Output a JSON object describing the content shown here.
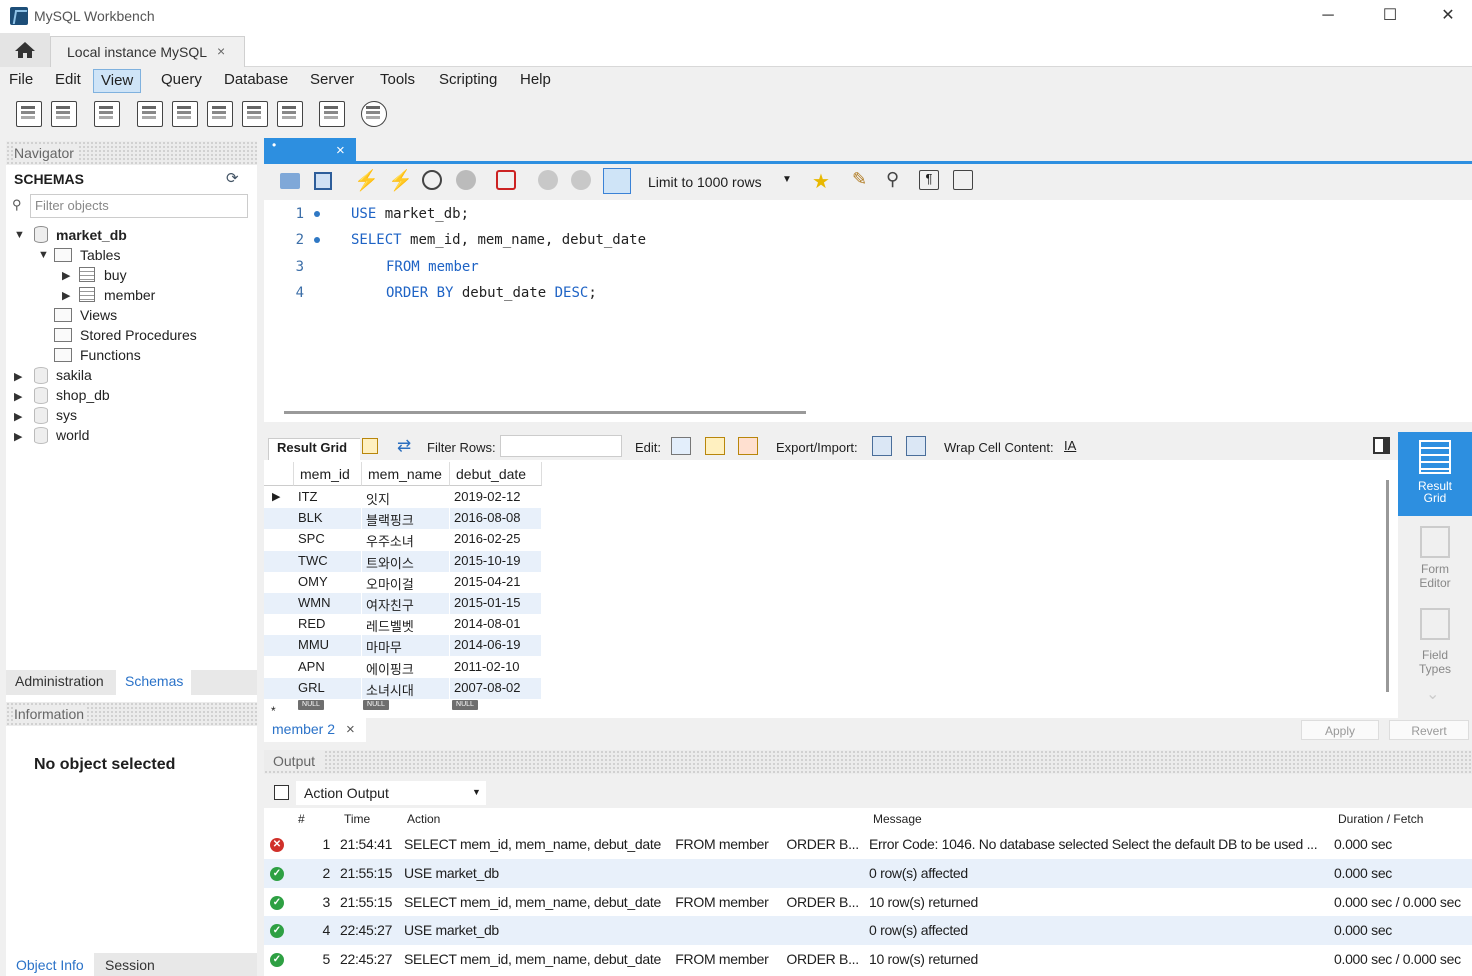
{
  "window": {
    "title": "MySQL Workbench",
    "minimize": "─",
    "maximize": "☐",
    "close": "✕"
  },
  "connection_tab": {
    "label": "Local instance MySQL",
    "close": "×"
  },
  "menu": [
    "File",
    "Edit",
    "View",
    "Query",
    "Database",
    "Server",
    "Tools",
    "Scripting",
    "Help"
  ],
  "navigator": {
    "header": "Navigator",
    "schemas_title": "SCHEMAS",
    "filter_placeholder": "Filter objects",
    "tree": {
      "db": "market_db",
      "tables": "Tables",
      "table_items": [
        "buy",
        "member"
      ],
      "views": "Views",
      "stored_procedures": "Stored Procedures",
      "functions": "Functions",
      "other_dbs": [
        "sakila",
        "shop_db",
        "sys",
        "world"
      ]
    },
    "tabs": [
      "Administration",
      "Schemas"
    ],
    "info_header": "Information",
    "no_object": "No object selected",
    "bottom_tabs": [
      "Object Info",
      "Session"
    ]
  },
  "editor": {
    "tab_label": "•",
    "limit_label": "Limit to 1000 rows",
    "lines": [
      {
        "num": "1",
        "marker": true,
        "parts": [
          [
            "kw",
            "USE"
          ],
          [
            "",
            "market_db;"
          ]
        ]
      },
      {
        "num": "2",
        "marker": true,
        "parts": [
          [
            "kw",
            "SELECT"
          ],
          [
            "",
            "mem_id, mem_name, debut_date"
          ]
        ]
      },
      {
        "num": "3",
        "marker": false,
        "parts": [
          [
            "kw",
            "FROM"
          ],
          [
            "kw",
            "member"
          ]
        ]
      },
      {
        "num": "4",
        "marker": false,
        "parts": [
          [
            "kw",
            "ORDER BY"
          ],
          [
            "",
            "debut_date"
          ],
          [
            "kw",
            "DESC"
          ],
          [
            "",
            ";"
          ]
        ]
      }
    ]
  },
  "result_toolbar": {
    "result_grid": "Result Grid",
    "filter_rows": "Filter Rows:",
    "edit": "Edit:",
    "export_import": "Export/Import:",
    "wrap": "Wrap Cell Content:"
  },
  "grid": {
    "columns": [
      "mem_id",
      "mem_name",
      "debut_date"
    ],
    "rows": [
      [
        "ITZ",
        "잇지",
        "2019-02-12"
      ],
      [
        "BLK",
        "블랙핑크",
        "2016-08-08"
      ],
      [
        "SPC",
        "우주소녀",
        "2016-02-25"
      ],
      [
        "TWC",
        "트와이스",
        "2015-10-19"
      ],
      [
        "OMY",
        "오마이걸",
        "2015-04-21"
      ],
      [
        "WMN",
        "여자친구",
        "2015-01-15"
      ],
      [
        "RED",
        "레드벨벳",
        "2014-08-01"
      ],
      [
        "MMU",
        "마마무",
        "2014-06-19"
      ],
      [
        "APN",
        "에이핑크",
        "2011-02-10"
      ],
      [
        "GRL",
        "소녀시대",
        "2007-08-02"
      ]
    ],
    "null_label": "NULL"
  },
  "side_panel": [
    "Result\nGrid",
    "Form\nEditor",
    "Field\nTypes"
  ],
  "result_tabs": {
    "tab": "member 2",
    "close": "×",
    "apply": "Apply",
    "revert": "Revert"
  },
  "output": {
    "header": "Output",
    "selector": "Action Output",
    "columns": [
      "#",
      "Time",
      "Action",
      "Message",
      "Duration / Fetch"
    ],
    "rows": [
      {
        "status": "error",
        "num": "1",
        "time": "21:54:41",
        "action": "SELECT mem_id, mem_name, debut_date    FROM member     ORDER B...",
        "message": "Error Code: 1046. No database selected Select the default DB to be used ...",
        "duration": "0.000 sec"
      },
      {
        "status": "ok",
        "num": "2",
        "time": "21:55:15",
        "action": "USE market_db",
        "message": "0 row(s) affected",
        "duration": "0.000 sec"
      },
      {
        "status": "ok",
        "num": "3",
        "time": "21:55:15",
        "action": "SELECT mem_id, mem_name, debut_date    FROM member     ORDER B...",
        "message": "10 row(s) returned",
        "duration": "0.000 sec / 0.000 sec"
      },
      {
        "status": "ok",
        "num": "4",
        "time": "22:45:27",
        "action": "USE market_db",
        "message": "0 row(s) affected",
        "duration": "0.000 sec"
      },
      {
        "status": "ok",
        "num": "5",
        "time": "22:45:27",
        "action": "SELECT mem_id, mem_name, debut_date    FROM member     ORDER B...",
        "message": "10 row(s) returned",
        "duration": "0.000 sec / 0.000 sec"
      }
    ]
  }
}
